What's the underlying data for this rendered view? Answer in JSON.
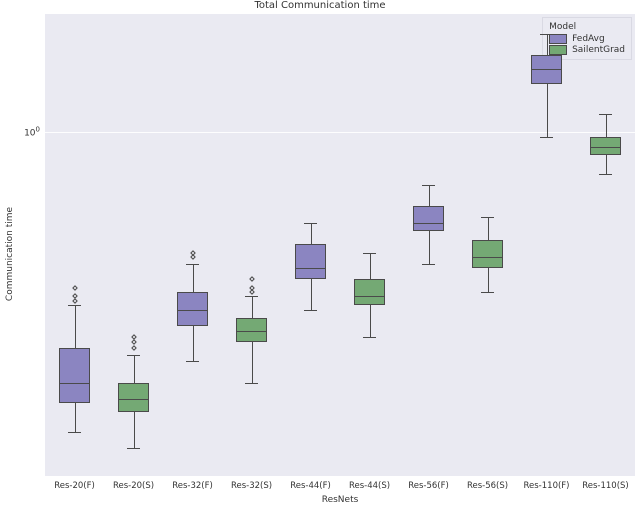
{
  "title": "Total Communication time",
  "xlabel": "ResNets",
  "ylabel": "Communication time",
  "ytick0_html": "10<sup>0</sup>",
  "legend": {
    "title": "Model",
    "items": [
      {
        "label": "FedAvg",
        "color": "purple"
      },
      {
        "label": "SailentGrad",
        "color": "green"
      }
    ]
  },
  "categories": [
    "Res-20(F)",
    "Res-20(S)",
    "Res-32(F)",
    "Res-32(S)",
    "Res-44(F)",
    "Res-44(S)",
    "Res-56(F)",
    "Res-56(S)",
    "Res-110(F)",
    "Res-110(S)"
  ],
  "chart_data": {
    "type": "box",
    "yscale": "log",
    "y_axis_range_log10": [
      -0.93,
      0.32
    ],
    "title": "Total Communication time",
    "xlabel": "ResNets",
    "ylabel": "Communication time",
    "legend_position": "upper right",
    "series": [
      {
        "name": "FedAvg",
        "color": "#8b85c1",
        "categories": [
          "Res-20(F)",
          "Res-32(F)",
          "Res-44(F)",
          "Res-56(F)",
          "Res-110(F)"
        ],
        "boxes": [
          {
            "whisker_low": 0.155,
            "q1": 0.185,
            "median": 0.21,
            "q3": 0.26,
            "whisker_high": 0.34,
            "outliers": [
              0.35,
              0.36,
              0.38
            ]
          },
          {
            "whisker_low": 0.24,
            "q1": 0.3,
            "median": 0.33,
            "q3": 0.37,
            "whisker_high": 0.44,
            "outliers": [
              0.46,
              0.47
            ]
          },
          {
            "whisker_low": 0.33,
            "q1": 0.4,
            "median": 0.43,
            "q3": 0.5,
            "whisker_high": 0.57,
            "outliers": []
          },
          {
            "whisker_low": 0.44,
            "q1": 0.54,
            "median": 0.57,
            "q3": 0.63,
            "whisker_high": 0.72,
            "outliers": []
          },
          {
            "whisker_low": 0.97,
            "q1": 1.35,
            "median": 1.48,
            "q3": 1.62,
            "whisker_high": 1.85,
            "outliers": []
          }
        ]
      },
      {
        "name": "SailentGrad",
        "color": "#74a974",
        "categories": [
          "Res-20(S)",
          "Res-32(S)",
          "Res-44(S)",
          "Res-56(S)",
          "Res-110(S)"
        ],
        "boxes": [
          {
            "whisker_low": 0.14,
            "q1": 0.175,
            "median": 0.19,
            "q3": 0.21,
            "whisker_high": 0.25,
            "outliers": [
              0.26,
              0.27,
              0.28
            ]
          },
          {
            "whisker_low": 0.21,
            "q1": 0.27,
            "median": 0.29,
            "q3": 0.315,
            "whisker_high": 0.36,
            "outliers": [
              0.37,
              0.38,
              0.4
            ]
          },
          {
            "whisker_low": 0.28,
            "q1": 0.34,
            "median": 0.36,
            "q3": 0.4,
            "whisker_high": 0.47,
            "outliers": []
          },
          {
            "whisker_low": 0.37,
            "q1": 0.43,
            "median": 0.46,
            "q3": 0.51,
            "whisker_high": 0.59,
            "outliers": []
          },
          {
            "whisker_low": 0.77,
            "q1": 0.87,
            "median": 0.91,
            "q3": 0.97,
            "whisker_high": 1.12,
            "outliers": []
          }
        ]
      }
    ]
  }
}
